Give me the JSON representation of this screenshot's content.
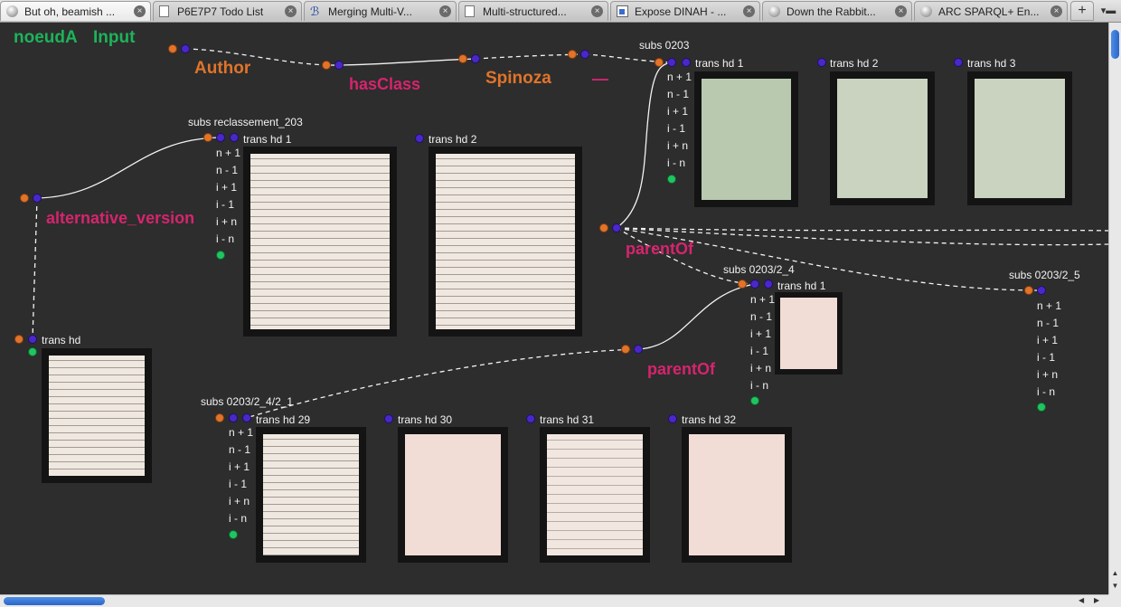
{
  "tabs": [
    {
      "label": "But oh, beamish ...",
      "icon": "globe-icon",
      "active": true
    },
    {
      "label": "P6E7P7 Todo List",
      "icon": "document-icon",
      "active": false
    },
    {
      "label": "Merging Multi-V...",
      "icon": "script-b-icon",
      "active": false
    },
    {
      "label": "Multi-structured...",
      "icon": "document-icon",
      "active": false
    },
    {
      "label": "Expose DINAH - ...",
      "icon": "page-icon",
      "active": false
    },
    {
      "label": "Down the Rabbit...",
      "icon": "globe-icon",
      "active": false
    },
    {
      "label": "ARC SPARQL+ En...",
      "icon": "globe-icon",
      "active": false
    }
  ],
  "new_tab_label": "+",
  "graph_header": {
    "noeud": "noeudA",
    "input": "Input"
  },
  "labels": {
    "author": "Author",
    "hasclass": "hasClass",
    "spinoza": "Spinoza",
    "dash": "—",
    "alternative_version": "alternative_version",
    "parentof_1": "parentOf",
    "parentof_2": "parentOf"
  },
  "nodes": {
    "subs_0203": "subs 0203",
    "subs_reclassement": "subs reclassement_203",
    "subs_0203_2_4": "subs 0203/2_4",
    "subs_0203_2_5": "subs 0203/2_5",
    "subs_0203_2_4_2_1": "subs 0203/2_4/2_1"
  },
  "trans": {
    "t0203_1": "trans hd 1",
    "t0203_2": "trans hd 2",
    "t0203_3": "trans hd 3",
    "trecl_1": "trans hd 1",
    "trecl_2": "trans hd 2",
    "tleft": "trans hd",
    "t24_1": "trans hd 1",
    "t29": "trans hd 29",
    "t30": "trans hd 30",
    "t31": "trans hd 31",
    "t32": "trans hd 32"
  },
  "controls": [
    "n + 1",
    "n - 1",
    "i + 1",
    "i - 1",
    "i + n",
    "i - n"
  ],
  "colors": {
    "background": "#2d2d2d",
    "orange": "#e0742a",
    "pink": "#d6246e",
    "green": "#1db35a",
    "purple": "#4a28c8"
  }
}
